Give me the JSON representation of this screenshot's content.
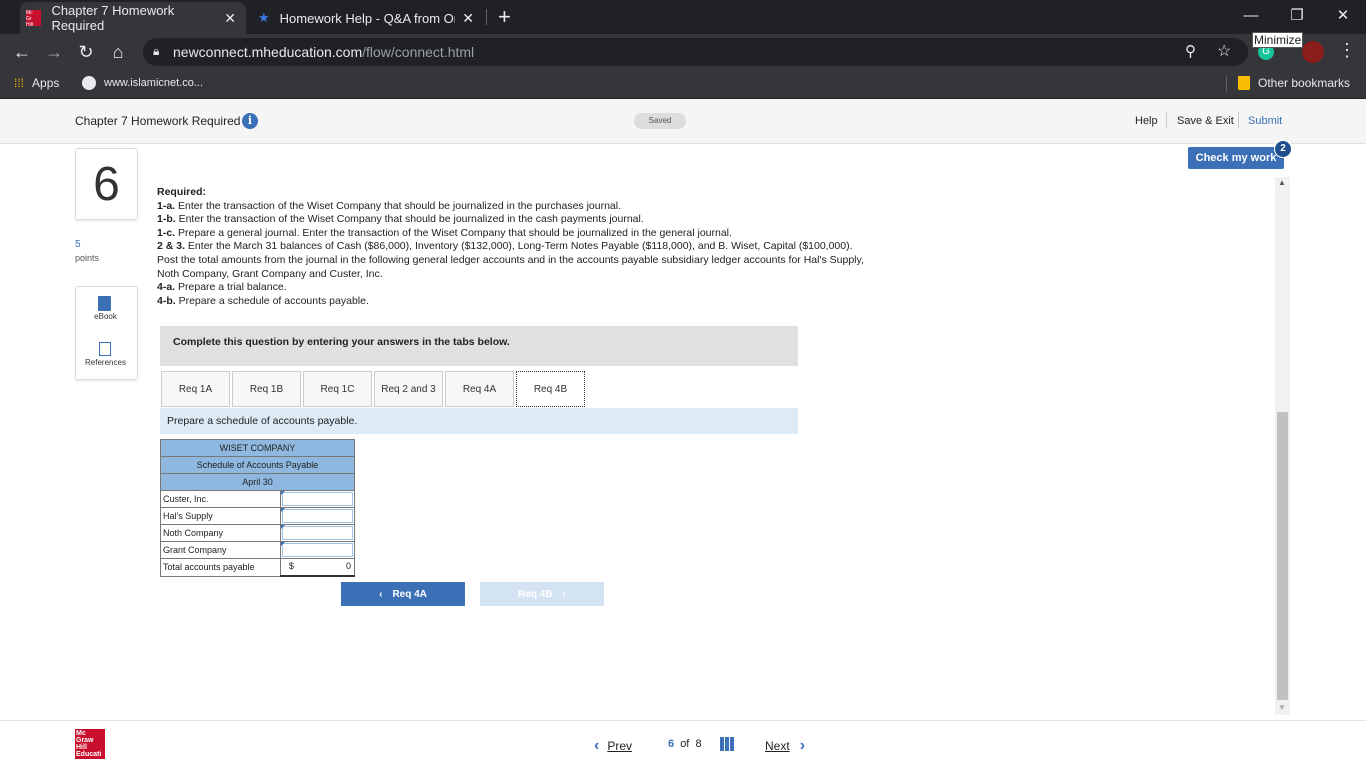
{
  "browser": {
    "tabs": [
      {
        "title": "Chapter 7 Homework Required",
        "active": true
      },
      {
        "title": "Homework Help - Q&A from Onl",
        "active": false
      }
    ],
    "new_tab": "+",
    "minimize_tooltip": "Minimize",
    "url_domain": "newconnect.mheducation.com",
    "url_path": "/flow/connect.html",
    "bookmarks": [
      {
        "label": "Apps"
      },
      {
        "label": "www.islamicnet.co..."
      }
    ],
    "other_bookmarks": "Other bookmarks",
    "extension_badge": "G"
  },
  "header": {
    "title": "Chapter 7 Homework Required",
    "saved_badge": "Saved",
    "help": "Help",
    "save_exit": "Save & Exit",
    "submit": "Submit",
    "check_my_work": "Check my work",
    "check_badge": "2"
  },
  "question": {
    "number": "6",
    "points_value": "5",
    "points_label": "points",
    "ebook": "eBook",
    "references": "References",
    "required_heading": "Required:",
    "items": [
      {
        "tag": "1-a.",
        "text": " Enter the transaction of the Wiset Company that should be journalized in the purchases journal."
      },
      {
        "tag": "1-b.",
        "text": " Enter the transaction of the Wiset Company that should be journalized in the cash payments journal."
      },
      {
        "tag": "1-c.",
        "text": " Prepare a general journal. Enter the transaction of the Wiset Company that should be journalized in the general journal."
      },
      {
        "tag": "2 & 3.",
        "text": " Enter the March 31 balances of Cash ($86,000), Inventory ($132,000), Long-Term Notes Payable ($118,000), and B. Wiset, Capital ($100,000). Post the total amounts from the journal in the following general ledger accounts and in the accounts payable subsidiary ledger accounts for Hal's Supply, Noth Company, Grant Company and Custer, Inc."
      },
      {
        "tag": "4-a.",
        "text": " Prepare a trial balance."
      },
      {
        "tag": "4-b.",
        "text": " Prepare a schedule of accounts payable."
      }
    ],
    "complete_prompt": "Complete this question by entering your answers in the tabs below.",
    "tabs": [
      "Req 1A",
      "Req 1B",
      "Req 1C",
      "Req 2 and 3",
      "Req 4A",
      "Req 4B"
    ],
    "selected_tab": "Req 4B",
    "tab_instruction": "Prepare a schedule of accounts payable."
  },
  "schedule": {
    "company": "WISET COMPANY",
    "title": "Schedule of Accounts Payable",
    "date": "April 30",
    "rows": [
      {
        "label": "Custer, Inc.",
        "value": ""
      },
      {
        "label": "Hal's Supply",
        "value": ""
      },
      {
        "label": "Noth Company",
        "value": ""
      },
      {
        "label": "Grant Company",
        "value": ""
      }
    ],
    "total_label": "Total accounts payable",
    "total_currency": "$",
    "total_value": "0"
  },
  "qnav": {
    "prev_label": "Req 4A",
    "next_label": "Req 4B"
  },
  "footer": {
    "logo_text": "Mc Graw Hill Education",
    "prev": "Prev",
    "current": "6",
    "of": "of",
    "total": "8",
    "next": "Next"
  },
  "colors": {
    "brand_blue": "#3b6fb6",
    "mh_red": "#c8102e",
    "table_header": "#8fb8e0",
    "instruction_bar": "#dcebf6"
  }
}
